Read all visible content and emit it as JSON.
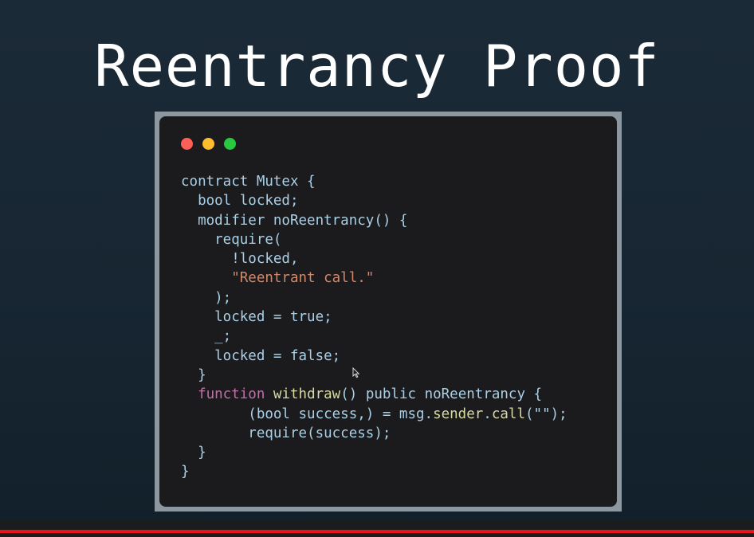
{
  "slide": {
    "title": "Reentrancy Proof"
  },
  "code_window": {
    "traffic_lights": [
      "close",
      "minimize",
      "maximize"
    ],
    "lines": [
      [
        {
          "t": "contract Mutex {",
          "k": "plain"
        }
      ],
      [
        {
          "t": "  bool locked;",
          "k": "plain"
        }
      ],
      [
        {
          "t": "  modifier noReentrancy() {",
          "k": "plain"
        }
      ],
      [
        {
          "t": "    require(",
          "k": "plain"
        }
      ],
      [
        {
          "t": "      !locked,",
          "k": "plain"
        }
      ],
      [
        {
          "t": "      ",
          "k": "plain"
        },
        {
          "t": "\"Reentrant call.\"",
          "k": "str"
        }
      ],
      [
        {
          "t": "    );",
          "k": "plain"
        }
      ],
      [
        {
          "t": "    locked = true;",
          "k": "plain"
        }
      ],
      [
        {
          "t": "    _;",
          "k": "plain"
        }
      ],
      [
        {
          "t": "    locked = false;",
          "k": "plain"
        }
      ],
      [
        {
          "t": "  }",
          "k": "plain"
        }
      ],
      [
        {
          "t": "  ",
          "k": "plain"
        },
        {
          "t": "function",
          "k": "fn-kw"
        },
        {
          "t": " ",
          "k": "plain"
        },
        {
          "t": "withdraw",
          "k": "fn-name"
        },
        {
          "t": "() public noReentrancy {",
          "k": "plain"
        }
      ],
      [
        {
          "t": "        (bool success,) = msg.",
          "k": "plain"
        },
        {
          "t": "sender",
          "k": "fn-name"
        },
        {
          "t": ".",
          "k": "plain"
        },
        {
          "t": "call",
          "k": "fn-name"
        },
        {
          "t": "(\"\");",
          "k": "plain"
        }
      ],
      [
        {
          "t": "        require(success);",
          "k": "plain"
        }
      ],
      [
        {
          "t": "  }",
          "k": "plain"
        }
      ],
      [
        {
          "t": "}",
          "k": "plain"
        }
      ]
    ]
  },
  "player": {
    "progress": 1.0
  },
  "colors": {
    "background": "#172632",
    "code_bg": "#1b1a1d",
    "code_text": "#a9d0e6",
    "keyword_function": "#c16fa8",
    "function_name": "#d9d9a2",
    "string": "#d3896a",
    "progress": "#e7141d"
  },
  "icons": {
    "close": "close-dot-icon",
    "minimize": "minimize-dot-icon",
    "maximize": "maximize-dot-icon",
    "cursor": "mouse-cursor-icon"
  }
}
